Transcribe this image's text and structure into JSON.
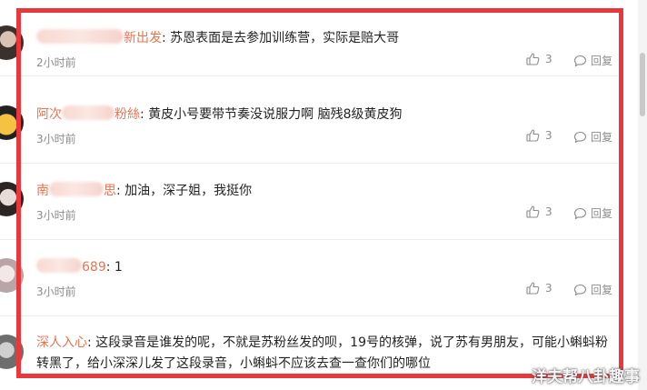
{
  "comments": [
    {
      "username_visible": "新出发",
      "separator": ":",
      "text": "苏恩表面是去参加训练营，实际是赔大哥",
      "time": "2小时前",
      "likes": "3",
      "reply_label": "回复"
    },
    {
      "username_visible_start": "阿次",
      "username_visible_end": "粉絲",
      "separator": ":",
      "text": "黄皮小号要带节奏没说服力啊  脑残8级黄皮狗",
      "time": "3小时前",
      "likes": "3",
      "reply_label": "回复"
    },
    {
      "username_visible_start": "南",
      "username_visible_end": "思",
      "separator": ":",
      "text": "加油，深子姐，我挺你",
      "time": "3小时前",
      "likes": "3",
      "reply_label": "回复"
    },
    {
      "username_visible": "689",
      "separator": ":",
      "text": "1",
      "time": "3小时前",
      "likes": "3",
      "reply_label": "回复"
    },
    {
      "username": "深人入心",
      "separator": ":",
      "text": "这段录音是谁发的呢，不就是苏粉丝发的呗，19号的核弹，说了苏有男朋友，可能小蝌蚪粉转黑了，给小深深儿发了这段录音，小蝌蚪不应该去查一查你们的哪位"
    }
  ],
  "watermark": "洋夫帮八卦趣事",
  "colors": {
    "username": "#eb7350",
    "highlight_frame": "#e8383b",
    "meta_text": "#8c8c8c"
  },
  "icons": {
    "like": "thumbs-up-icon",
    "reply": "speech-bubble-icon"
  }
}
